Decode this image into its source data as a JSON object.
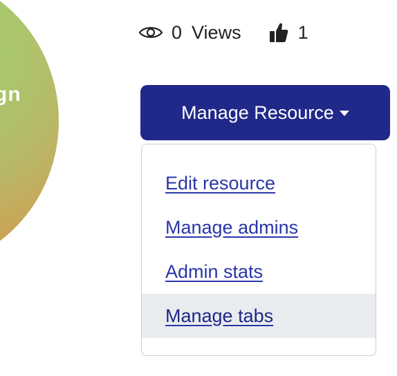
{
  "thumbnail": {
    "partial_text": "gn"
  },
  "stats": {
    "views_icon": "eye-icon",
    "views_count": "0",
    "views_label": "Views",
    "likes_icon": "thumbs-up-icon",
    "likes_count": "1"
  },
  "manage_button": {
    "label": "Manage Resource",
    "color": "#20298a",
    "caret_icon": "caret-down-icon"
  },
  "menu": {
    "items": [
      {
        "label": "Edit resource"
      },
      {
        "label": "Manage admins"
      },
      {
        "label": "Admin stats"
      },
      {
        "label": "Manage tabs"
      }
    ],
    "link_color": "#2a36a8",
    "hover_bg": "#e9ecef"
  }
}
